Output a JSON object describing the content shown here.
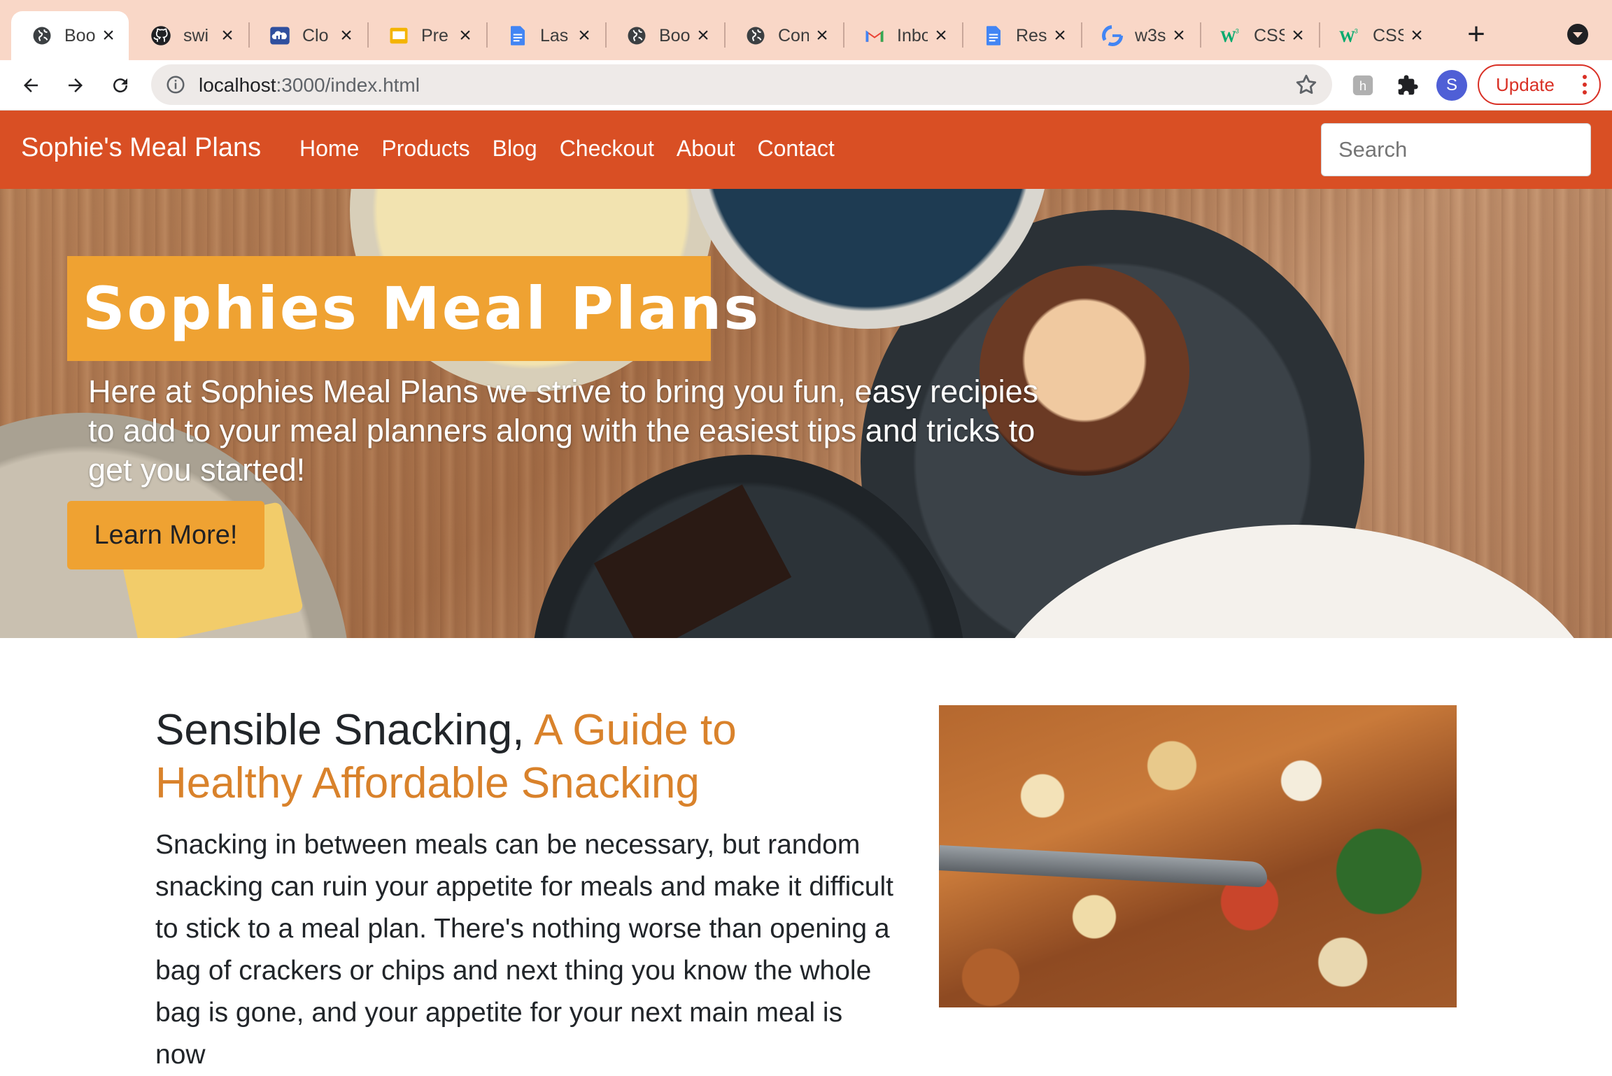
{
  "browser": {
    "tabs": [
      {
        "title": "Boo",
        "icon": "globe-icon",
        "active": true
      },
      {
        "title": "swi",
        "icon": "github-icon",
        "active": false
      },
      {
        "title": "Clo",
        "icon": "cloud-icon",
        "active": false
      },
      {
        "title": "Pre",
        "icon": "slides-icon",
        "active": false
      },
      {
        "title": "Las",
        "icon": "docs-icon",
        "active": false
      },
      {
        "title": "Boo",
        "icon": "globe-icon",
        "active": false
      },
      {
        "title": "Con",
        "icon": "globe-icon",
        "active": false
      },
      {
        "title": "Inbo",
        "icon": "gmail-icon",
        "active": false
      },
      {
        "title": "Res",
        "icon": "docs-icon",
        "active": false
      },
      {
        "title": "w3s",
        "icon": "google-icon",
        "active": false
      },
      {
        "title": "CSS",
        "icon": "w3schools-icon",
        "active": false
      },
      {
        "title": "CSS",
        "icon": "w3schools-icon",
        "active": false
      }
    ],
    "url_host": "localhost",
    "url_path": ":3000/index.html",
    "avatar_letter": "S",
    "update_label": "Update"
  },
  "site": {
    "brand": "Sophie's Meal Plans",
    "nav": [
      "Home",
      "Products",
      "Blog",
      "Checkout",
      "About",
      "Contact"
    ],
    "search_placeholder": "Search",
    "accent_color": "#d94f24",
    "highlight_color": "#efa232"
  },
  "hero": {
    "title": "Sophies Meal Plans",
    "text": "Here at Sophies Meal Plans we strive to bring you fun, easy recipies to add to your meal planners along with the easiest tips and tricks to get you started!",
    "button": "Learn More!"
  },
  "content": {
    "heading_main": "Sensible Snacking, ",
    "heading_accent": "A Guide to Healthy Affordable Snacking",
    "body": "Snacking in between meals can be necessary, but random snacking can ruin your appetite for meals and make it difficult to stick to a meal plan. There's nothing worse than opening a bag of crackers or chips and next thing you know the whole bag is gone, and your appetite for your next main meal is now"
  }
}
